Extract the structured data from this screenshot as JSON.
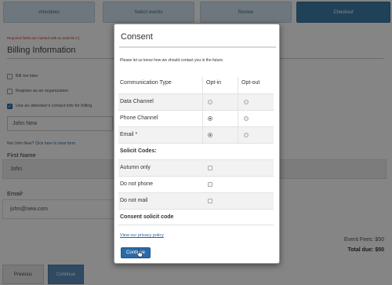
{
  "steps": [
    "Attendees",
    "Select events",
    "Review",
    "Checkout"
  ],
  "background": {
    "required_note": "Required fields are marked with an asterisk (*).",
    "section_title": "Billing Information",
    "checkboxes": [
      {
        "label": "Bill me later"
      },
      {
        "label": "Register as an organization"
      },
      {
        "label": "Use an attendee's contact info for billing"
      }
    ],
    "attendee_select_value": "John New",
    "not_john_text": "Not John New?",
    "clear_form_link": "Click here to clear form",
    "first_name_label": "First Name",
    "first_name_value": "John",
    "email_label": "Email",
    "email_value": "john@new.com",
    "event_fees": "Event Fees: $50",
    "total_due": "Total due: $50",
    "previous_button": "Previous",
    "continue_button": "Continue"
  },
  "modal": {
    "title": "Consent",
    "intro": "Please let us know how we should contact you in the future.",
    "headers": {
      "type": "Communication Type",
      "opt_in": "Opt-in",
      "opt_out": "Opt-out"
    },
    "channels": [
      {
        "name": "Data Channel",
        "opt_in_selected": false
      },
      {
        "name": "Phone Channel",
        "opt_in_selected": true
      },
      {
        "name": "Email *",
        "opt_in_selected": true
      }
    ],
    "solicit_header": "Solicit Codes:",
    "solicit_codes": [
      {
        "name": "Autumn only",
        "checked": false
      },
      {
        "name": "Do not phone",
        "checked": false
      },
      {
        "name": "Do not mail",
        "checked": false
      }
    ],
    "consent_code_label": "Consent solicit code",
    "privacy_link": "View our privacy policy",
    "continue_button": "Continue"
  }
}
